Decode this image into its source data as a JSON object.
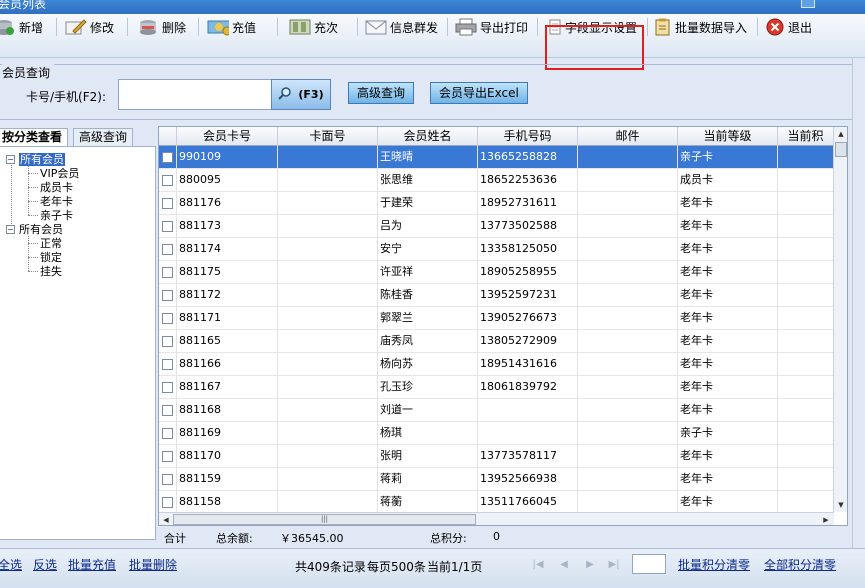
{
  "window": {
    "title": "会员列表"
  },
  "toolbar": {
    "add": "新增",
    "edit": "修改",
    "delete": "删除",
    "recharge": "充值",
    "recharge_count": "充次",
    "broadcast": "信息群发",
    "export_print": "导出打印",
    "field_display": "字段显示设置",
    "batch_import": "批量数据导入",
    "exit": "退出"
  },
  "query": {
    "group_title": "会员查询",
    "card_label": "卡号/手机(F2):",
    "card_value": "",
    "search_hotkey": "(F3)",
    "advanced_query": "高级查询",
    "export_excel": "会员导出Excel"
  },
  "left_tabs": {
    "by_category": "按分类查看",
    "advanced": "高级查询"
  },
  "tree": {
    "all_members": "所有会员",
    "card_types": [
      "VIP会员",
      "成员卡",
      "老年卡",
      "亲子卡"
    ],
    "all_members_2": "所有会员",
    "states": [
      "正常",
      "锁定",
      "挂失"
    ]
  },
  "table": {
    "columns": [
      "",
      "会员卡号",
      "卡面号",
      "会员姓名",
      "手机号码",
      "邮件",
      "当前等级",
      "当前积"
    ],
    "rows": [
      {
        "card": "990109",
        "face": "",
        "name": "王晓晴",
        "phone": "13665258828",
        "email": "",
        "level": "亲子卡"
      },
      {
        "card": "880095",
        "face": "",
        "name": "张思维",
        "phone": "18652253636",
        "email": "",
        "level": "成员卡"
      },
      {
        "card": "881176",
        "face": "",
        "name": "于建荣",
        "phone": "18952731611",
        "email": "",
        "level": "老年卡"
      },
      {
        "card": "881173",
        "face": "",
        "name": "吕为",
        "phone": "13773502588",
        "email": "",
        "level": "老年卡"
      },
      {
        "card": "881174",
        "face": "",
        "name": "安宁",
        "phone": "13358125050",
        "email": "",
        "level": "老年卡"
      },
      {
        "card": "881175",
        "face": "",
        "name": "许亚祥",
        "phone": "18905258955",
        "email": "",
        "level": "老年卡"
      },
      {
        "card": "881172",
        "face": "",
        "name": "陈桂香",
        "phone": "13952597231",
        "email": "",
        "level": "老年卡"
      },
      {
        "card": "881171",
        "face": "",
        "name": "郭翠兰",
        "phone": "13905276673",
        "email": "",
        "level": "老年卡"
      },
      {
        "card": "881165",
        "face": "",
        "name": "庙秀凤",
        "phone": "13805272909",
        "email": "",
        "level": "老年卡"
      },
      {
        "card": "881166",
        "face": "",
        "name": "杨向苏",
        "phone": "18951431616",
        "email": "",
        "level": "老年卡"
      },
      {
        "card": "881167",
        "face": "",
        "name": "孔玉珍",
        "phone": "18061839792",
        "email": "",
        "level": "老年卡"
      },
      {
        "card": "881168",
        "face": "",
        "name": "刘道一",
        "phone": "",
        "email": "",
        "level": "老年卡"
      },
      {
        "card": "881169",
        "face": "",
        "name": "杨琪",
        "phone": "",
        "email": "",
        "level": "亲子卡"
      },
      {
        "card": "881170",
        "face": "",
        "name": "张明",
        "phone": "13773578117",
        "email": "",
        "level": "老年卡"
      },
      {
        "card": "881159",
        "face": "",
        "name": "蒋莉",
        "phone": "13952566938",
        "email": "",
        "level": "老年卡"
      },
      {
        "card": "881158",
        "face": "",
        "name": "蒋蘅",
        "phone": "13511766045",
        "email": "",
        "level": "老年卡"
      }
    ]
  },
  "totals": {
    "label": "合计",
    "balance_label": "总余额:",
    "balance_value": "￥36545.00",
    "points_label": "总积分:",
    "points_value": "0"
  },
  "footer": {
    "select_all": "全选",
    "invert": "反选",
    "batch_recharge": "批量充值",
    "batch_delete": "批量删除",
    "records": "共409条记录",
    "per_page": "每页500条",
    "current_page": "当前1/1页",
    "clear_points_batch": "批量积分清零",
    "clear_points_all": "全部积分清零"
  },
  "colors": {
    "selection": "#3a78d6",
    "highlight_box": "#e0201c",
    "link": "#0b2a8a"
  }
}
